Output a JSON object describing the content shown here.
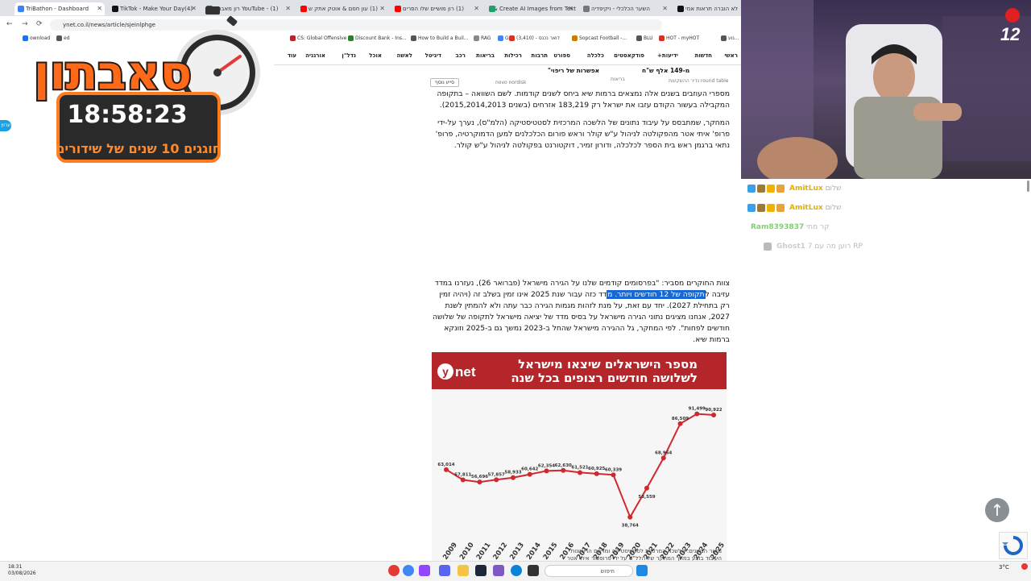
{
  "tabs": [
    {
      "title": "TriBathon - Dashboard",
      "color": "#3b82f6",
      "active": true
    },
    {
      "title": "(4)TikTok - Make Your Day",
      "color": "#111111"
    },
    {
      "title": "YouTube - (1) רון מאבתון",
      "color": "#ff0000"
    },
    {
      "title": "(1) עון חסם & אוטק אתק ש",
      "color": "#ff0000"
    },
    {
      "title": "(1) רון מושיים שלו הפרים",
      "color": "#ff0000"
    },
    {
      "title": "Create AI Images from Text &",
      "color": "#22a06b"
    },
    {
      "title": "השער הכלכלי - ויקיפדיה",
      "color": "#777777"
    },
    {
      "title": "לא הוברה תראות אמי",
      "color": "#111111"
    }
  ],
  "browser": {
    "url": "ynet.co.il/news/article/sjeinlphge"
  },
  "bookmarks": [
    {
      "label": "ownload",
      "color": "#1a73e8"
    },
    {
      "label": "ed",
      "color": "#555555"
    },
    {
      "label": "CS: Global Offensive",
      "color": "#b5262b"
    },
    {
      "label": "Discount Bank - Ins...",
      "color": "#2e7d32"
    },
    {
      "label": "How to Build a Buil...",
      "color": "#555555"
    },
    {
      "label": "RAG",
      "color": "#888888"
    },
    {
      "label": "G",
      "color": "#4285f4"
    },
    {
      "label": "(3,410) - דואר נכנס",
      "color": "#d93025"
    },
    {
      "label": "Sopcast Football -...",
      "color": "#c77d00"
    },
    {
      "label": "BLU",
      "color": "#555555"
    },
    {
      "label": "HOT - myHOT",
      "color": "#d93025"
    },
    {
      "label": "נוע...",
      "color": "#555555"
    }
  ],
  "sitenav": [
    "ראשי",
    "חדשות",
    "ידיעות+",
    "פודקאסטים",
    "כלכלה",
    "ספורט",
    "תרבות",
    "רכילות",
    "בריאות",
    "רכב",
    "דיגיטל",
    "לאשה",
    "אוכל",
    "נדל\"ן",
    "אורגניה",
    "עוד"
  ],
  "article": {
    "topfrag1": "מ-149 אלף ש\"ח",
    "topfrag2": "אפשרות של ריפוי\"",
    "small1": "round table נדיר ההשקעות",
    "small2": "בריאות",
    "small3": "novo nordisk",
    "small_button": "סייע נוסף",
    "p1": "מספרי העוזבים בשנים אלה נמצאים ברמות שיא ביחס לשנים קודמות. לשם השוואה – בתקופה המקבילה בעשור הקודם עזבו את ישראל רק 183,219 אזרחים (בשנים 2015,2014,2013).",
    "p2": "המחקר, שמתבסס על עיבוד נתונים של הלשכה המרכזית לסטטיסטיקה (הלמ\"ס), נערך על-ידי פרופ' איתי אטר מהפקולטה לניהול ע\"ש קולר וראש פורום הכלכלנים למען הדמוקרטיה, פרופ' נתאי ברגמן ראש בית הספר לכלכלה, ודורון זמיר, דוקטורנט בפקולטה לניהול ע\"ש קולר.",
    "p3_before": "צוות החוקרים מסביר: \"בפרסומים קודמים שלנו על הגירה מישראל (פברואר 26), נעזרנו במדד עזיבה ל",
    "p3_highlight": "תקופה של 12 חודשים ויותר. מ",
    "p3_after": "דד כזה עבור שנת 2025 אינו זמין בשלב זה (ויהיה זמין רק בתחילת 2027). יחד עם זאת, על מנת לזהות מגמות הגירה כבר עתה ולא להמתין לשנת 2027, אנחנו מציגים נתוני הגירה מישראל על בסיס מדד של יציאה מישראל לתקופה של שלושה חודשים לפחות\". לפי המחקר, גל ההגירה מישראל שהחל ב-2023 נמשך גם ב-2025 וזונקא ברמות שיא.",
    "source_line1": "מקור הנתונים: הלשכה המרכזית לסטטיסטיקה ומרשם הרשיונות",
    "source_line2": "העיבוד בוצע במהך המחקר של הלל\"ס על ידי פרופסור איתי אטר"
  },
  "chart_data": {
    "type": "line",
    "title": "מספר הישראלים שיצאו מישראל לשלושה חודשים רצופים בכל שנה",
    "logo_text": "ynet",
    "x": [
      "2009",
      "2010",
      "2011",
      "2012",
      "2013",
      "2014",
      "2015",
      "2016",
      "2017",
      "2018",
      "2019",
      "2020",
      "2021",
      "2022",
      "2023",
      "2024",
      "2025"
    ],
    "values": [
      63014,
      57811,
      56696,
      57857,
      58933,
      60642,
      62354,
      62630,
      61521,
      60925,
      60339,
      38764,
      53559,
      68964,
      86509,
      91499,
      90922
    ],
    "labels": [
      "63,014",
      "57,811",
      "56,696",
      "57,857",
      "58,933",
      "60,642",
      "62,354",
      "62,630",
      "61,521",
      "60,925",
      "60,339",
      "38,764",
      "53,559",
      "68,964",
      "86,509",
      "91,499",
      "90,922"
    ],
    "ylim": [
      30000,
      100000
    ],
    "grid": false,
    "line_color": "#d0282f"
  },
  "overlay": {
    "word": "סאבתון",
    "timer": "18:58:23",
    "subtitle": "חוגגים 10 שנים של שידורים"
  },
  "webcam": {
    "channel_logo": "12"
  },
  "chat": [
    {
      "user": "AmitLux",
      "text": "שלום"
    },
    {
      "user": "AmitLux",
      "text": "שלום"
    },
    {
      "user": "Ram8393837",
      "text": "קר מתי"
    },
    {
      "user": "Ghost1",
      "text": "רוען מה עם 7 RP"
    }
  ],
  "left_badge": "ערוץ",
  "taskbar": {
    "time": "18:31",
    "date": "03/08/2026",
    "weather": "3°C",
    "search": "חיפוש"
  }
}
